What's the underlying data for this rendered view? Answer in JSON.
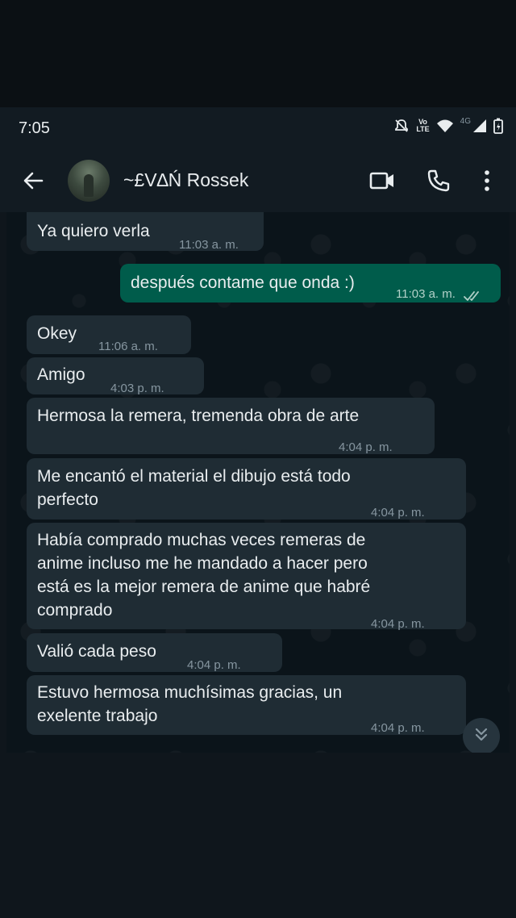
{
  "status": {
    "time": "7:05",
    "network": "4G",
    "volte": "Vo\nLTE"
  },
  "header": {
    "contact_name": "~£V∆Ń Rossek"
  },
  "messages": [
    {
      "text": "Ya quiero verla",
      "time": "11:03 a. m."
    },
    {
      "text": "después contame que onda :)",
      "time": "11:03 a. m."
    },
    {
      "text": "Okey",
      "time": "11:06 a. m."
    },
    {
      "text": "Amigo",
      "time": "4:03 p. m."
    },
    {
      "text": "Hermosa la remera, tremenda obra de arte",
      "time": "4:04 p. m."
    },
    {
      "line1": "Me encantó el material el dibujo está todo",
      "line2": "perfecto",
      "time": "4:04 p. m."
    },
    {
      "line1": "Había comprado muchas veces remeras de",
      "line2": "anime incluso me he mandado a hacer pero",
      "line3": "está es la mejor remera de anime que habré",
      "line4": "comprado",
      "time": "4:04 p. m."
    },
    {
      "text": "Valió cada peso",
      "time": "4:04 p. m."
    },
    {
      "line1": "Estuvo hermosa muchísimas gracias, un",
      "line2": "exelente trabajo",
      "time": "4:04 p. m."
    }
  ],
  "colors": {
    "incoming_bubble": "#1f2c34",
    "outgoing_bubble": "#005c4b",
    "header_bg": "#121b22",
    "read_ticks": "#8696a0"
  },
  "icons": [
    "back-arrow-icon",
    "video-call-icon",
    "voice-call-icon",
    "more-options-icon",
    "scroll-down-icon",
    "mute-icon",
    "wifi-icon",
    "signal-icon",
    "battery-icon"
  ]
}
